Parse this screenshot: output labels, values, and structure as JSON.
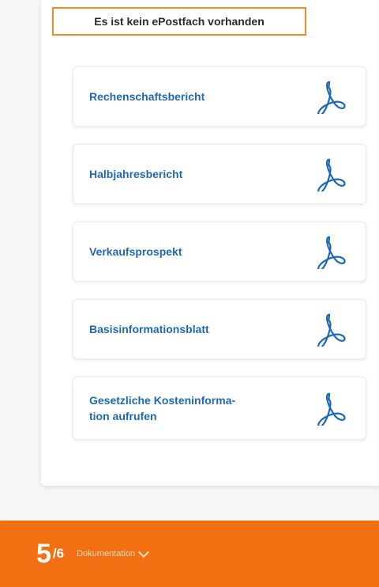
{
  "notice": {
    "text": "Es ist kein ePostfach vorhanden"
  },
  "documents": [
    {
      "label": "Rechenschaftsbericht",
      "icon": "pdf-icon"
    },
    {
      "label": "Halbjahresbericht",
      "icon": "pdf-icon"
    },
    {
      "label": "Verkaufsprospekt",
      "icon": "pdf-icon"
    },
    {
      "label": "Basisinformationsblatt",
      "icon": "pdf-icon"
    },
    {
      "label": "Gesetzliche Kosteninforma-\ntion aufrufen",
      "icon": "pdf-icon"
    }
  ],
  "progress": {
    "current": "5",
    "total": "/6",
    "step_name": "Dokumentation"
  },
  "colors": {
    "accent": "#f26f12",
    "notice_border": "#f08a24",
    "link": "#1f68b6"
  }
}
